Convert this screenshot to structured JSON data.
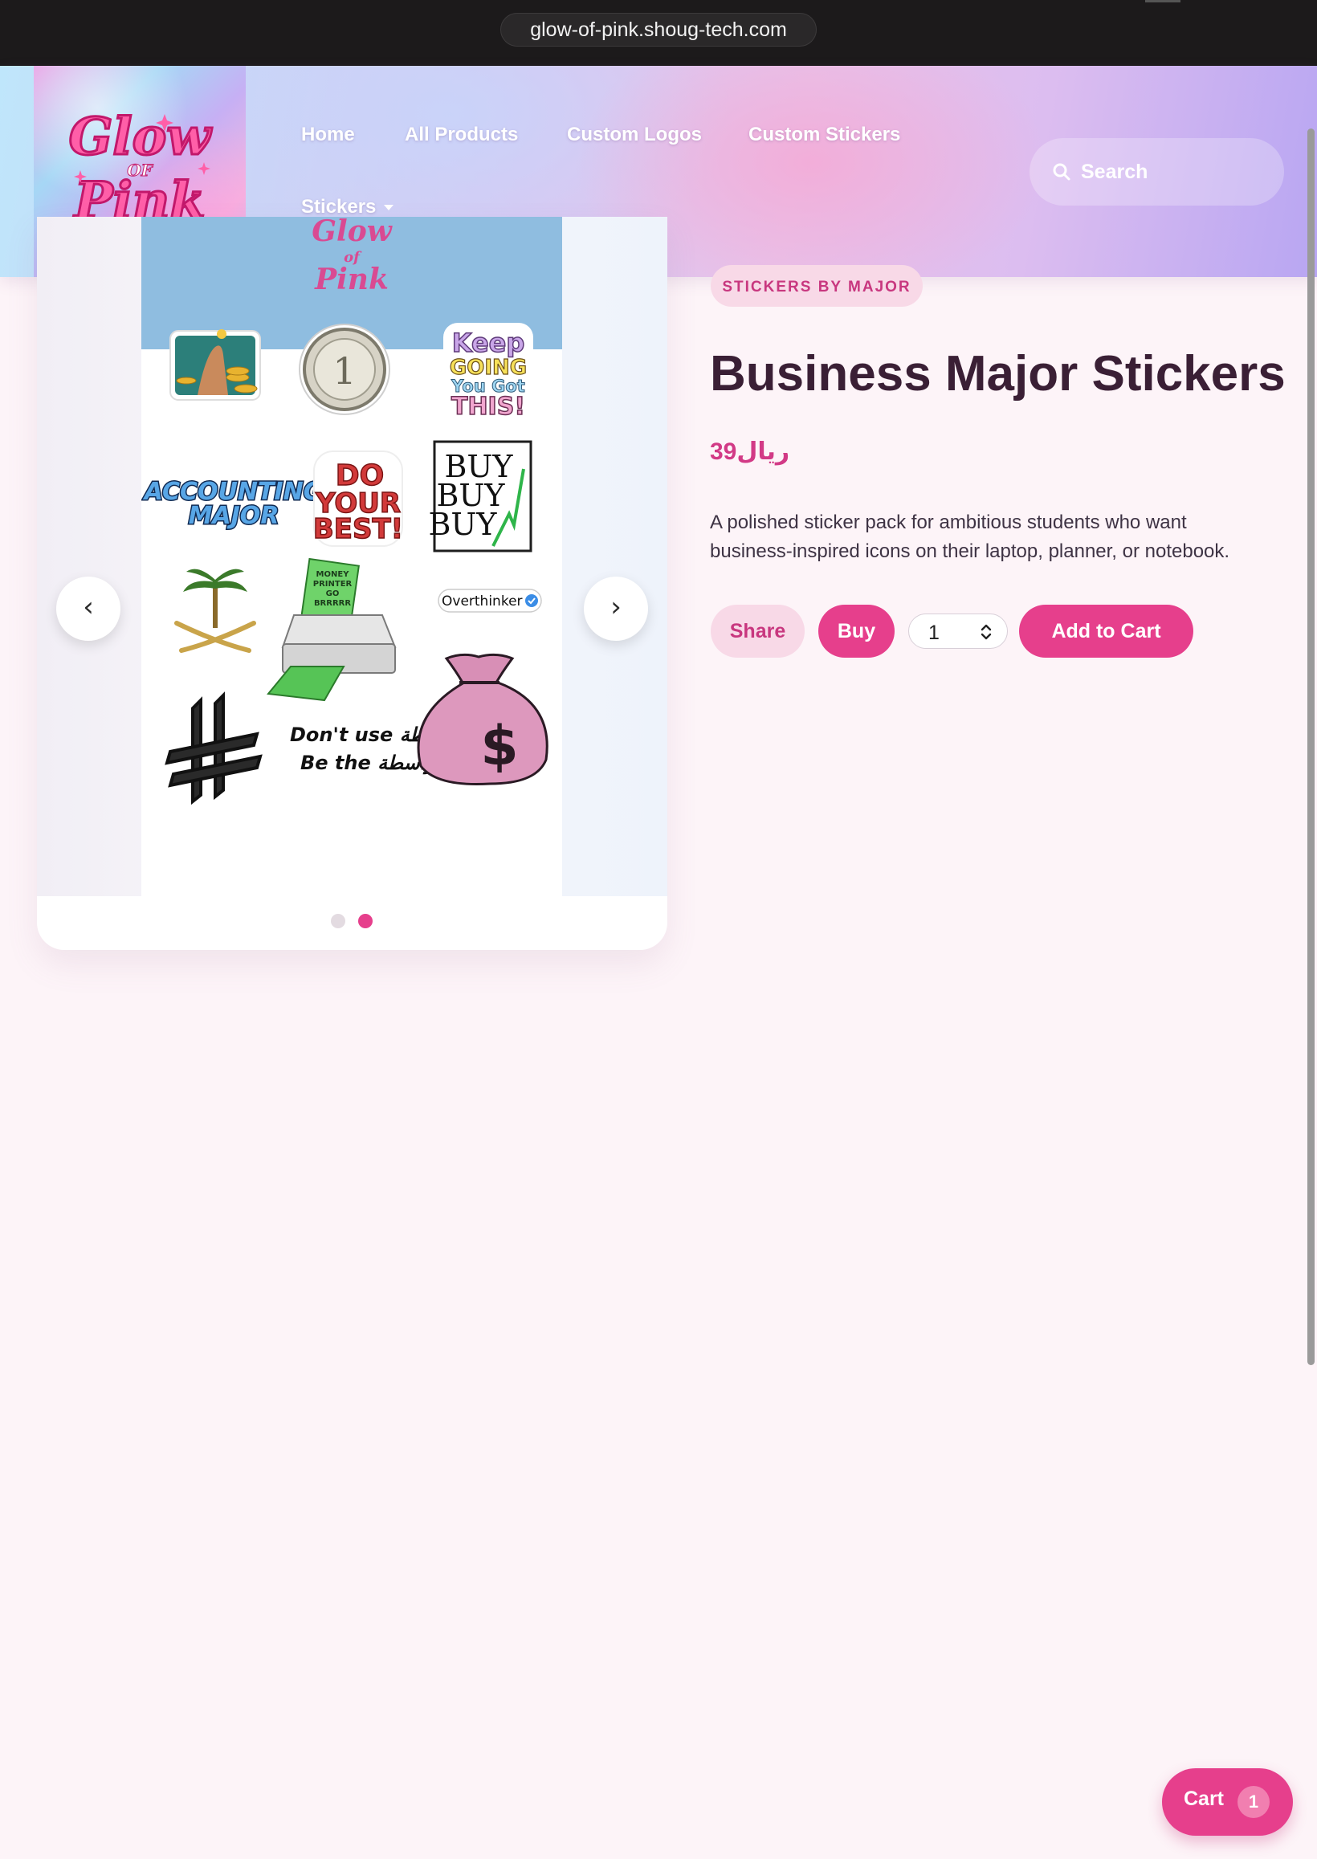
{
  "browser": {
    "url": "glow-of-pink.shoug-tech.com"
  },
  "header": {
    "logo": {
      "line1": "Glow",
      "line2": "OF",
      "line3": "Pink"
    },
    "nav": [
      {
        "label": "Home"
      },
      {
        "label": "All Products"
      },
      {
        "label": "Custom Logos"
      },
      {
        "label": "Custom Stickers"
      },
      {
        "label": "Stickers"
      }
    ],
    "search": {
      "placeholder": "Search"
    }
  },
  "gallery": {
    "sheet_header": {
      "line1": "Glow",
      "line2": "of",
      "line3": "Pink"
    },
    "stickers": {
      "coin_text": "1",
      "keep_going_1": "Keep",
      "keep_going_2": "GOING",
      "keep_going_3": "You Got",
      "keep_going_4": "THIS!",
      "accounting_1": "ACCOUNTING",
      "accounting_2": "MAJOR",
      "do_best_1": "DO",
      "do_best_2": "YOUR",
      "do_best_3": "BEST!",
      "buy_1": "BUY",
      "buy_2": "BUY",
      "buy_3": "BUY",
      "printer_1": "MONEY",
      "printer_2": "PRINTER",
      "printer_3": "GO",
      "printer_4": "BRRRRR",
      "overthinker": "Overthinker",
      "wasta_1": "Don't use واسطة",
      "wasta_2": "Be the واسطة",
      "money_bag": "$"
    },
    "prev_label": "‹",
    "next_label": "›",
    "total_slides": 2,
    "active_slide": 2
  },
  "product": {
    "category": "STICKERS BY MAJOR",
    "title": "Business Major Stickers",
    "price": "39ريال",
    "description": "A polished sticker pack for ambitious students who want business-inspired icons on their laptop, planner, or notebook.",
    "share_label": "Share",
    "buy_label": "Buy",
    "quantity": "1",
    "add_to_cart_label": "Add to Cart"
  },
  "cart": {
    "label": "Cart",
    "count": "1"
  },
  "colors": {
    "accent": "#e63f8c",
    "accent_soft": "#f8d9e7",
    "title_text": "#3a1f35",
    "page_bg": "#fdf4f8"
  }
}
